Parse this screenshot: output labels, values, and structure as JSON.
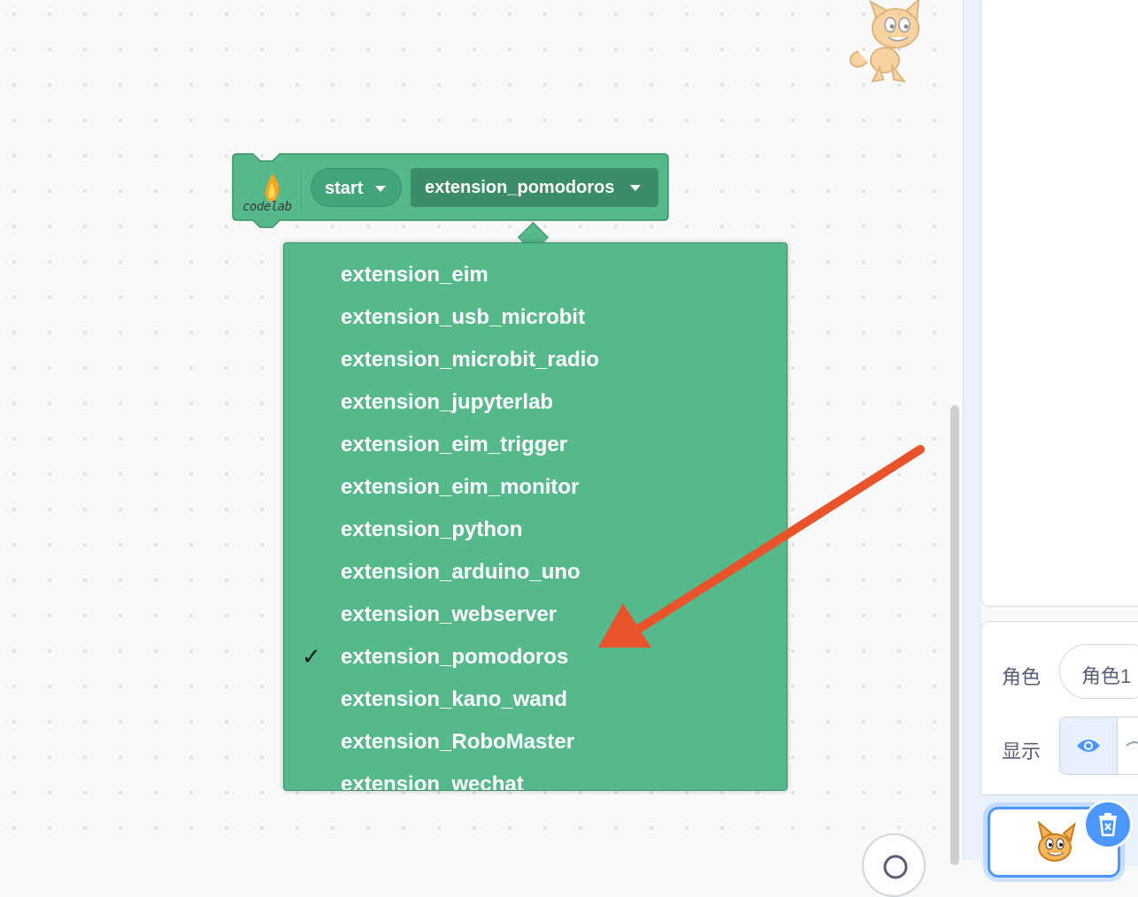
{
  "block": {
    "logo_text": "codelab",
    "start_label": "start",
    "extension_label": "extension_pomodoros"
  },
  "menu": {
    "items": [
      {
        "label": "extension_eim",
        "checked": false
      },
      {
        "label": "extension_usb_microbit",
        "checked": false
      },
      {
        "label": "extension_microbit_radio",
        "checked": false
      },
      {
        "label": "extension_jupyterlab",
        "checked": false
      },
      {
        "label": "extension_eim_trigger",
        "checked": false
      },
      {
        "label": "extension_eim_monitor",
        "checked": false
      },
      {
        "label": "extension_python",
        "checked": false
      },
      {
        "label": "extension_arduino_uno",
        "checked": false
      },
      {
        "label": "extension_webserver",
        "checked": false
      },
      {
        "label": "extension_pomodoros",
        "checked": true
      },
      {
        "label": "extension_kano_wand",
        "checked": false
      },
      {
        "label": "extension_RoboMaster",
        "checked": false
      },
      {
        "label": "extension_wechat",
        "checked": false
      }
    ],
    "check_glyph": "✓"
  },
  "sprite_info": {
    "sprite_label": "角色",
    "sprite_name": "角色1",
    "show_label": "显示"
  },
  "colors": {
    "block_green": "#55b98c",
    "annotation_arrow": "#e8532b",
    "accent_blue": "#4c97ff"
  },
  "icons": {
    "logo": "flame-icon",
    "show_visible": "eye-icon",
    "show_hidden": "eye-slash-icon",
    "delete": "trash-icon",
    "zoom": "zoom-icon"
  }
}
